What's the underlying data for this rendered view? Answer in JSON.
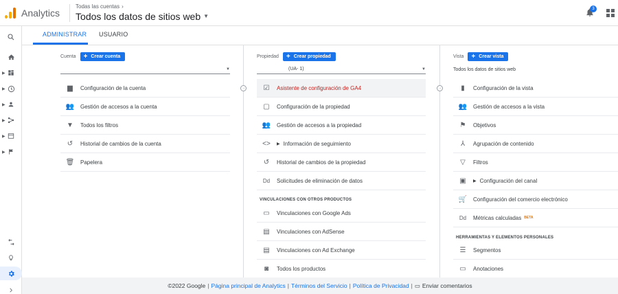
{
  "header": {
    "app_name": "Analytics",
    "breadcrumb": "Todas las cuentas",
    "title": "Todos los datos de sitios web",
    "notification_count": "3"
  },
  "tabs": {
    "admin": "ADMINISTRAR",
    "user": "USUARIO"
  },
  "account": {
    "label": "Cuenta",
    "create_label": "Crear cuenta",
    "selector_value": "",
    "items": [
      {
        "label": "Configuración de la cuenta",
        "icon": "building-icon"
      },
      {
        "label": "Gestión de accesos a la cuenta",
        "icon": "people-icon"
      },
      {
        "label": "Todos los filtros",
        "icon": "filter-icon"
      },
      {
        "label": "Historial de cambios de la cuenta",
        "icon": "history-icon"
      },
      {
        "label": "Papelera",
        "icon": "trash-icon"
      }
    ]
  },
  "property": {
    "label": "Propiedad",
    "create_label": "Crear propiedad",
    "selector_value": "(UA-             1)",
    "items": [
      {
        "label": "Asistente de configuración de GA4",
        "icon": "checkbox-icon"
      },
      {
        "label": "Configuración de la propiedad",
        "icon": "window-icon"
      },
      {
        "label": "Gestión de accesos a la propiedad",
        "icon": "people-icon"
      },
      {
        "label": "Información de seguimiento",
        "icon": "code-icon"
      },
      {
        "label": "Historial de cambios de la propiedad",
        "icon": "history-icon"
      },
      {
        "label": "Solicitudes de eliminación de datos",
        "icon": "dd-icon"
      }
    ],
    "links_heading": "VINCULACIONES CON OTROS PRODUCTOS",
    "links": [
      {
        "label": "Vinculaciones con Google Ads",
        "icon": "ads-icon"
      },
      {
        "label": "Vinculaciones con AdSense",
        "icon": "adsense-icon"
      },
      {
        "label": "Vinculaciones con Ad Exchange",
        "icon": "adexchange-icon"
      },
      {
        "label": "Todos los productos",
        "icon": "products-icon"
      }
    ]
  },
  "view": {
    "label": "Vista",
    "create_label": "Crear vista",
    "selector_value": "Todos los datos de sitios web",
    "items": [
      {
        "label": "Configuración de la vista",
        "icon": "document-icon"
      },
      {
        "label": "Gestión de accesos a la vista",
        "icon": "people-icon"
      },
      {
        "label": "Objetivos",
        "icon": "flag-icon"
      },
      {
        "label": "Agrupación de contenido",
        "icon": "grouping-icon"
      },
      {
        "label": "Filtros",
        "icon": "filter-icon"
      },
      {
        "label": "Configuración del canal",
        "icon": "channel-icon"
      },
      {
        "label": "Configuración del comercio electrónico",
        "icon": "cart-icon"
      },
      {
        "label": "Métricas calculadas",
        "icon": "dd-icon",
        "badge": "BETA"
      }
    ],
    "tools_heading": "HERRAMIENTAS Y ELEMENTOS PERSONALES",
    "tools": [
      {
        "label": "Segmentos",
        "icon": "segments-icon"
      },
      {
        "label": "Anotaciones",
        "icon": "annotations-icon"
      }
    ]
  },
  "footer": {
    "copyright": "©2022 Google",
    "home_link": "Página principal de Analytics",
    "terms_link": "Términos del Servicio",
    "privacy_link": "Política de Privacidad",
    "feedback": "Enviar comentarios"
  },
  "colors": {
    "accent": "#1a73e8",
    "highlight_text": "#c5221f",
    "logo_orange": "#e37400",
    "logo_yellow": "#f9ab00"
  }
}
